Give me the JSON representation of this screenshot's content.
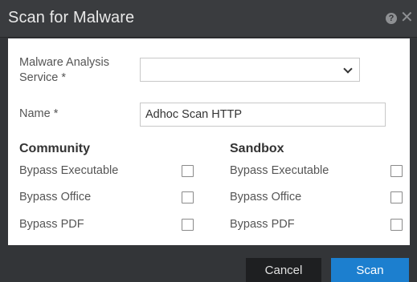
{
  "dialog": {
    "title": "Scan for Malware",
    "help_icon": "question-circle-icon",
    "close_icon": "close-icon",
    "close_glyph": "✕",
    "help_glyph": "?"
  },
  "form": {
    "service_label_line1": "Malware Analysis",
    "service_label_line2": "Service *",
    "service_value": "",
    "name_label": "Name *",
    "name_value": "Adhoc Scan HTTP"
  },
  "community": {
    "heading": "Community",
    "options": [
      {
        "label": "Bypass Executable",
        "checked": false
      },
      {
        "label": "Bypass Office",
        "checked": false
      },
      {
        "label": "Bypass PDF",
        "checked": false
      }
    ]
  },
  "sandbox": {
    "heading": "Sandbox",
    "options": [
      {
        "label": "Bypass Executable",
        "checked": false
      },
      {
        "label": "Bypass Office",
        "checked": false
      },
      {
        "label": "Bypass PDF",
        "checked": false
      }
    ]
  },
  "buttons": {
    "cancel": "Cancel",
    "scan": "Scan"
  },
  "colors": {
    "primary": "#1c7fcf",
    "title_bar": "#3a3c3f"
  }
}
